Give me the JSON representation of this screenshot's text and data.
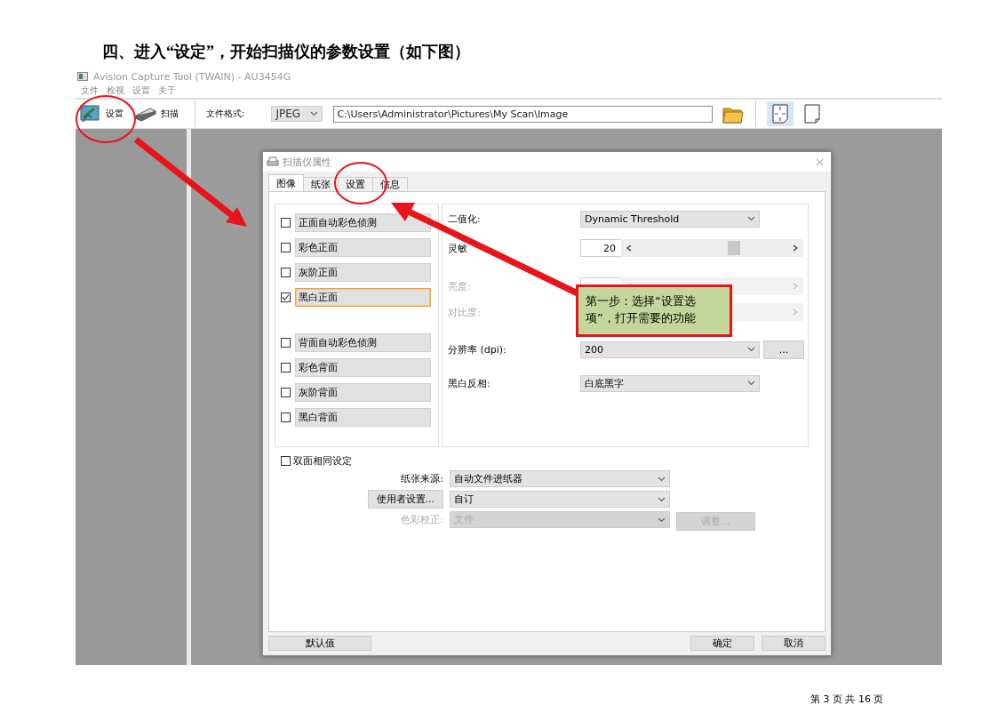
{
  "heading": "四、进入“设定”，开始扫描仪的参数设置（如下图）",
  "app": {
    "title": "Avision Capture Tool (TWAIN) - AU3454G",
    "menu": [
      "文件",
      "检视",
      "设置",
      "关于"
    ],
    "toolbar": [
      {
        "label": "设置",
        "kind": "settings"
      },
      {
        "label": "扫描",
        "kind": "scan"
      }
    ],
    "file_format_label": "文件格式:",
    "file_format": "JPEG",
    "path": "C:\\Users\\Administrator\\Pictures\\My Scan\\Image",
    "view_buttons": [
      {
        "kind": "crop",
        "selected": true
      },
      {
        "kind": "page",
        "selected": false
      }
    ]
  },
  "dialog": {
    "title": "扫描仪属性",
    "tabs": [
      {
        "label": "图像",
        "selected": true
      },
      {
        "label": "纸张",
        "selected": false
      },
      {
        "label": "设置",
        "selected": false
      },
      {
        "label": "信息",
        "selected": false
      }
    ],
    "front_types": [
      {
        "label": "正面自动彩色侦测",
        "checked": false
      },
      {
        "label": "彩色正面",
        "checked": false
      },
      {
        "label": "灰阶正面",
        "checked": false
      },
      {
        "label": "黑白正面",
        "checked": true
      }
    ],
    "back_types": [
      {
        "label": "背面自动彩色侦测",
        "checked": false
      },
      {
        "label": "彩色背面",
        "checked": false
      },
      {
        "label": "灰阶背面",
        "checked": false
      },
      {
        "label": "黑白背面",
        "checked": false
      }
    ],
    "settings": [
      {
        "kind": "select",
        "label": "二值化:",
        "value": "Dynamic Threshold",
        "disabled": false
      },
      {
        "kind": "slider",
        "label": "灵敏",
        "value": "20",
        "level": 0.64,
        "disabled": false
      },
      {
        "kind": "slider",
        "label": "亮度:",
        "disabled": true
      },
      {
        "kind": "slider",
        "label": "对比度:",
        "disabled": true
      },
      {
        "kind": "select",
        "label": "分辨率 (dpi):",
        "value": "200",
        "button": "...",
        "disabled": false
      },
      {
        "kind": "select",
        "label": "黑白反相:",
        "value": "白底黑字",
        "disabled": false
      }
    ],
    "duplex_same": {
      "label": "双面相同设定",
      "checked": false
    },
    "paper_rows": [
      {
        "kind": "label",
        "label": "纸张来源:",
        "value": "自动文件进纸器",
        "disabled": false
      },
      {
        "kind": "button",
        "label": "使用者设置...",
        "value": "自订",
        "disabled": false
      },
      {
        "kind": "label",
        "label": "色彩校正:",
        "value": "文件",
        "button": "调整...",
        "disabled": true
      }
    ],
    "default_button": "默认值",
    "buttons": [
      "确定",
      "取消"
    ]
  },
  "callout": "第一步：选择“设置选项”，打开需要的功能",
  "page_footer": "第 3 页 共 16 页"
}
